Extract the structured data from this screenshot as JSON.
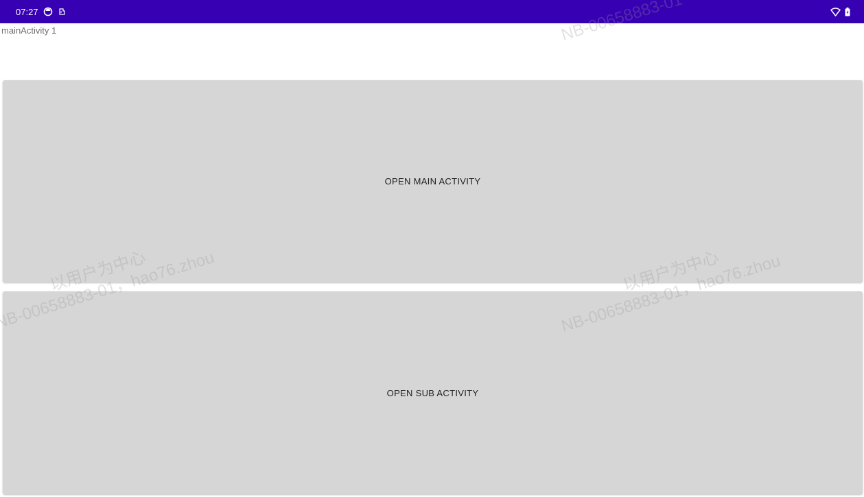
{
  "colors": {
    "status_bar": "#3700b3",
    "button_bg": "#d6d6d6",
    "button_text": "#1e1e1e",
    "label_text": "#6f6f6f",
    "page_bg": "#ffffff"
  },
  "status_bar": {
    "time": "07:27",
    "left_icons": [
      "sync-circle-icon",
      "sd-card-icon"
    ],
    "right_icons": [
      "wifi-icon",
      "battery-icon"
    ]
  },
  "app": {
    "label": "mainActivity 1"
  },
  "buttons": {
    "open_main": "OPEN MAIN ACTIVITY",
    "open_sub": "OPEN SUB ACTIVITY"
  },
  "watermark": {
    "line1": "以用户为中心",
    "line2": "NB-00658883-01，hao76.zhou",
    "line3": "NB-00658883-01"
  }
}
